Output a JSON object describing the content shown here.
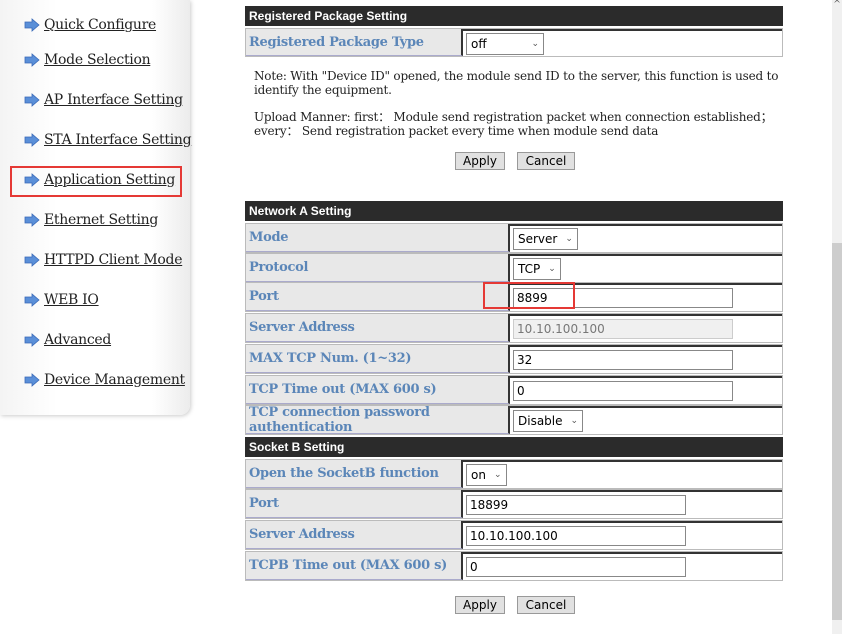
{
  "sidebar": {
    "items": [
      {
        "label": "Quick Configure"
      },
      {
        "label": "Mode Selection"
      },
      {
        "label": "AP Interface Setting"
      },
      {
        "label": "STA Interface Setting"
      },
      {
        "label": "Application Setting",
        "selected": true
      },
      {
        "label": "Ethernet Setting"
      },
      {
        "label": "HTTPD Client Mode"
      },
      {
        "label": "WEB IO"
      },
      {
        "label": "Advanced"
      },
      {
        "label": "Device Management"
      }
    ],
    "arrow_icon": "arrow-right-icon",
    "highlight_color": "#e53935"
  },
  "registered": {
    "title": "Registered Package Setting",
    "type_label": "Registered Package Type",
    "type_value": "off",
    "note1": "Note: With \"Device ID\" opened, the module send ID to the server, this function is used to identify the equipment.",
    "note2": "Upload Manner: first： Module send registration packet when connection established； every： Send registration packet every time when module send data",
    "apply": "Apply",
    "cancel": "Cancel"
  },
  "networkA": {
    "title": "Network A Setting",
    "rows": [
      {
        "label": "Mode",
        "value": "Server",
        "kind": "select"
      },
      {
        "label": "Protocol",
        "value": "TCP",
        "kind": "select"
      },
      {
        "label": "Port",
        "value": "8899",
        "kind": "input"
      },
      {
        "label": "Server Address",
        "value": "10.10.100.100",
        "kind": "disabled"
      },
      {
        "label": "MAX TCP Num. (1~32)",
        "value": "32",
        "kind": "input"
      },
      {
        "label": "TCP Time out (MAX 600 s)",
        "value": "0",
        "kind": "input"
      },
      {
        "label": "TCP connection password authentication",
        "value": "Disable",
        "kind": "select"
      }
    ]
  },
  "socketB": {
    "title": "Socket B Setting",
    "rows": [
      {
        "label": "Open the SocketB function",
        "value": "on",
        "kind": "select"
      },
      {
        "label": "Port",
        "value": "18899",
        "kind": "input"
      },
      {
        "label": "Server Address",
        "value": "10.10.100.100",
        "kind": "input"
      },
      {
        "label": "TCPB Time out (MAX 600 s)",
        "value": "0",
        "kind": "input"
      }
    ],
    "apply": "Apply",
    "cancel": "Cancel"
  }
}
